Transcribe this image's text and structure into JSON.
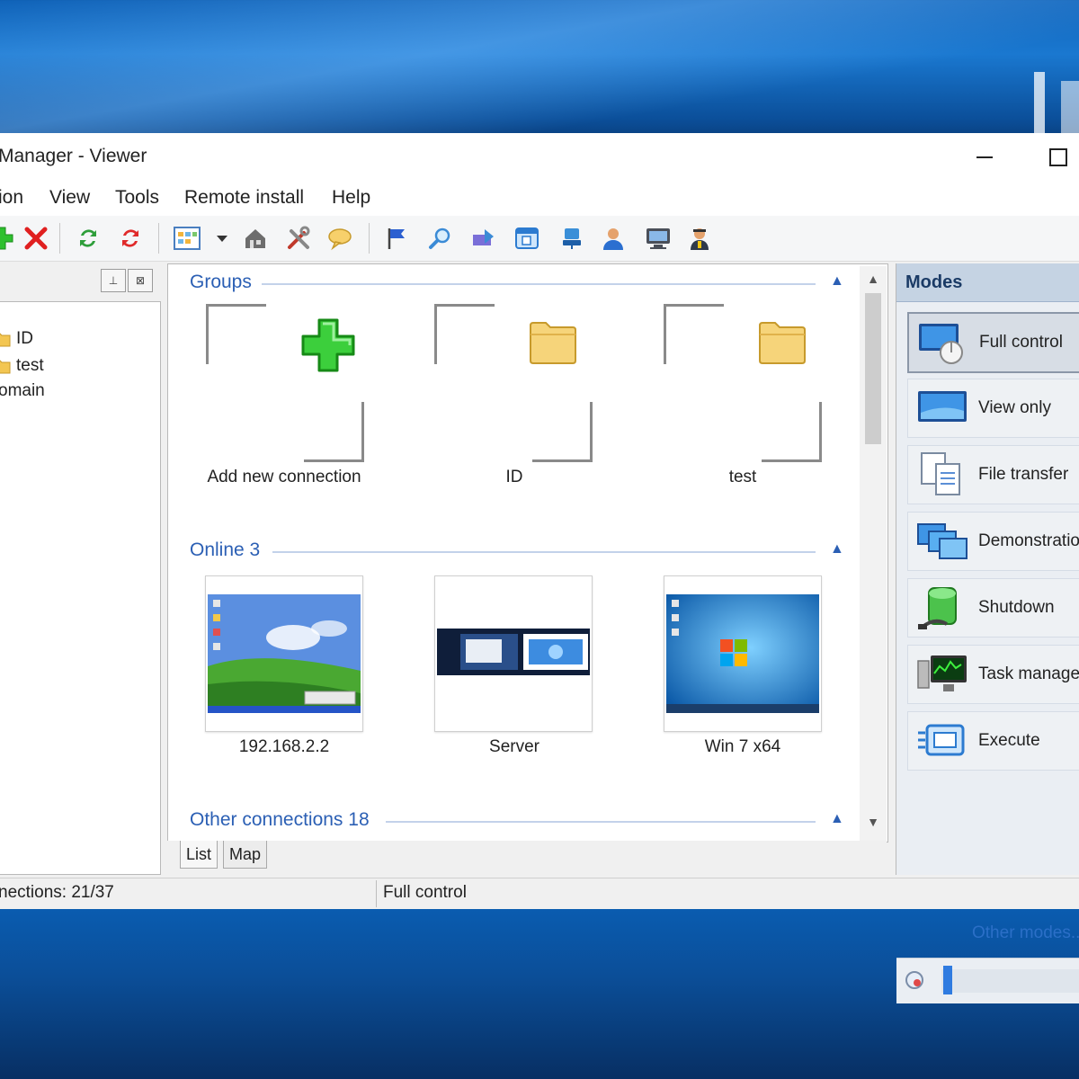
{
  "window": {
    "title": "Manager - Viewer",
    "minimize_glyph": "",
    "maximize_glyph": ""
  },
  "menu": [
    "ion",
    "View",
    "Tools",
    "Remote install",
    "Help"
  ],
  "toolbar": {
    "icons": [
      "add-icon",
      "delete-icon",
      "refresh-icon",
      "refresh-all-icon",
      "view-mode-icon",
      "dropdown-icon",
      "house-icon",
      "tools-icon",
      "chat-icon",
      "flag-icon",
      "search-icon",
      "transfer-icon",
      "window-icon",
      "network-icon",
      "user-icon",
      "monitor-icon",
      "admin-icon"
    ]
  },
  "left_pane": {
    "tree": [
      "ID",
      "test",
      "omain"
    ]
  },
  "center": {
    "groups": {
      "title": "Groups",
      "items": [
        "Add new connection",
        "ID",
        "test"
      ]
    },
    "online": {
      "title": "Online 3",
      "items": [
        "192.168.2.2",
        "Server",
        "Win 7 x64"
      ]
    },
    "other": {
      "title": "Other connections 18"
    },
    "tabs": [
      "List",
      "Map"
    ]
  },
  "modes": {
    "title": "Modes",
    "items": [
      "Full control",
      "View only",
      "File transfer",
      "Demonstratio",
      "Shutdown",
      "Task manage",
      "Execute"
    ],
    "other_link": "Other modes..."
  },
  "status": {
    "connections": "nections: 21/37",
    "mode": "Full control"
  },
  "colors": {
    "accent": "#2b5fb4",
    "desktop": "#0b4a8e",
    "add_green": "#2ec02e",
    "delete_red": "#e02020"
  }
}
